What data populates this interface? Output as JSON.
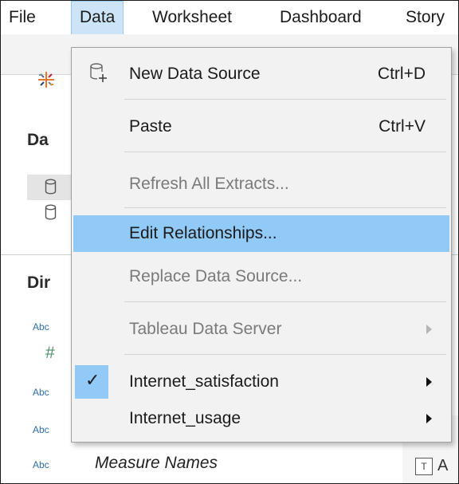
{
  "menubar": {
    "items": [
      "File",
      "Data",
      "Worksheet",
      "Dashboard",
      "Story"
    ]
  },
  "background": {
    "data_heading": "Da",
    "dimensions_heading": "Dir",
    "abc_label": "Abc",
    "hash_glyph": "#",
    "measure_names": "Measure Names",
    "t_icon": "T",
    "right_fragment": "A"
  },
  "data_menu": {
    "items": [
      {
        "label": "New Data Source",
        "shortcut": "Ctrl+D",
        "icon": "new-data-source-icon"
      },
      {
        "label": "Paste",
        "shortcut": "Ctrl+V"
      },
      {
        "label": "Refresh All Extracts...",
        "disabled": true
      },
      {
        "label": "Edit Relationships...",
        "highlighted": true
      },
      {
        "label": "Replace Data Source...",
        "disabled": true
      },
      {
        "label": "Tableau Data Server",
        "disabled": true,
        "submenu": true
      },
      {
        "label": "Internet_satisfaction",
        "checked": true,
        "submenu": true
      },
      {
        "label": "Internet_usage",
        "submenu": true
      }
    ],
    "check_glyph": "✓"
  },
  "colors": {
    "highlight": "#91c9f7",
    "menu_bg": "#f2f2f2",
    "open_menu_tab": "#cce4f7"
  }
}
